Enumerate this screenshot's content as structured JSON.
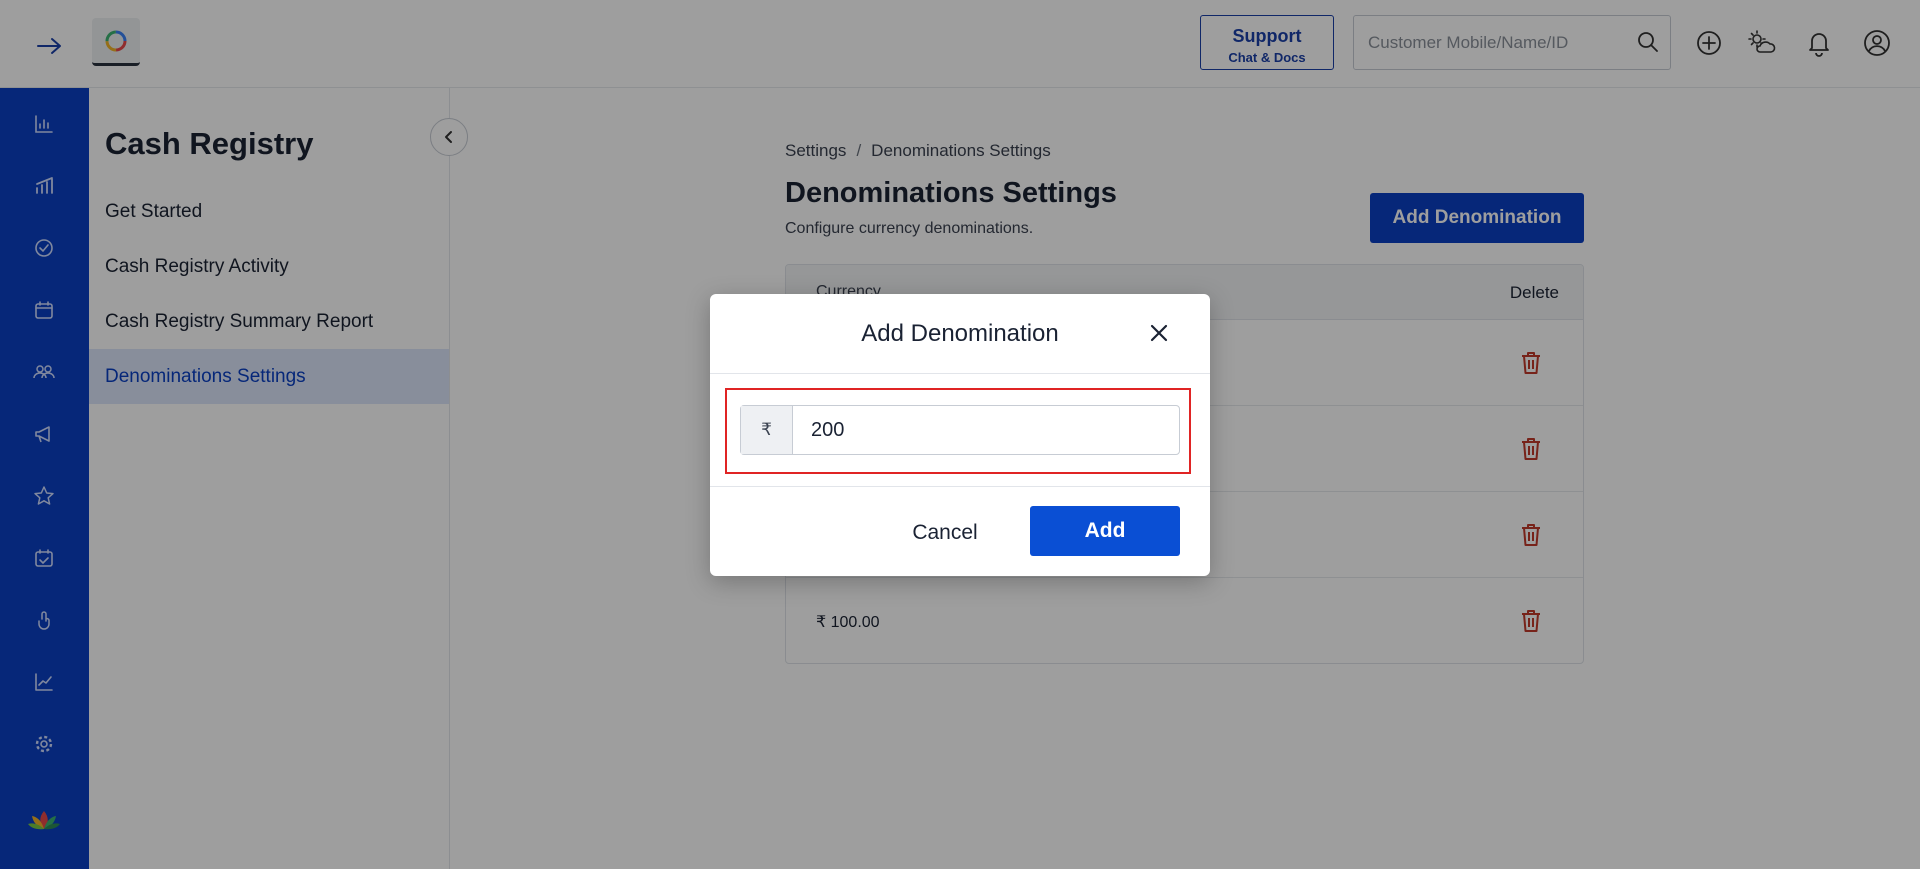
{
  "topbar": {
    "support_label": "Support",
    "support_sub": "Chat & Docs",
    "search_placeholder": "Customer Mobile/Name/ID"
  },
  "sidebar": {
    "title": "Cash Registry",
    "items": [
      {
        "label": "Get Started"
      },
      {
        "label": "Cash Registry Activity"
      },
      {
        "label": "Cash Registry Summary Report"
      },
      {
        "label": "Denominations Settings",
        "active": true
      }
    ]
  },
  "main": {
    "breadcrumb": [
      "Settings",
      "Denominations Settings"
    ],
    "breadcrumb_sep": "/",
    "title": "Denominations Settings",
    "subtitle": "Configure currency denominations.",
    "add_button": "Add Denomination",
    "table": {
      "columns": [
        "Currency",
        "Delete"
      ],
      "rows": [
        {
          "value": ""
        },
        {
          "value": ""
        },
        {
          "value": ""
        },
        {
          "value": "₹ 100.00"
        }
      ]
    }
  },
  "modal": {
    "title": "Add Denomination",
    "currency_symbol": "₹",
    "amount_value": "200",
    "cancel_label": "Cancel",
    "add_label": "Add"
  },
  "colors": {
    "brand": "#0a3fc4",
    "accent_button": "#0a4fd4",
    "danger": "#c0392b",
    "highlight": "#e02424"
  }
}
